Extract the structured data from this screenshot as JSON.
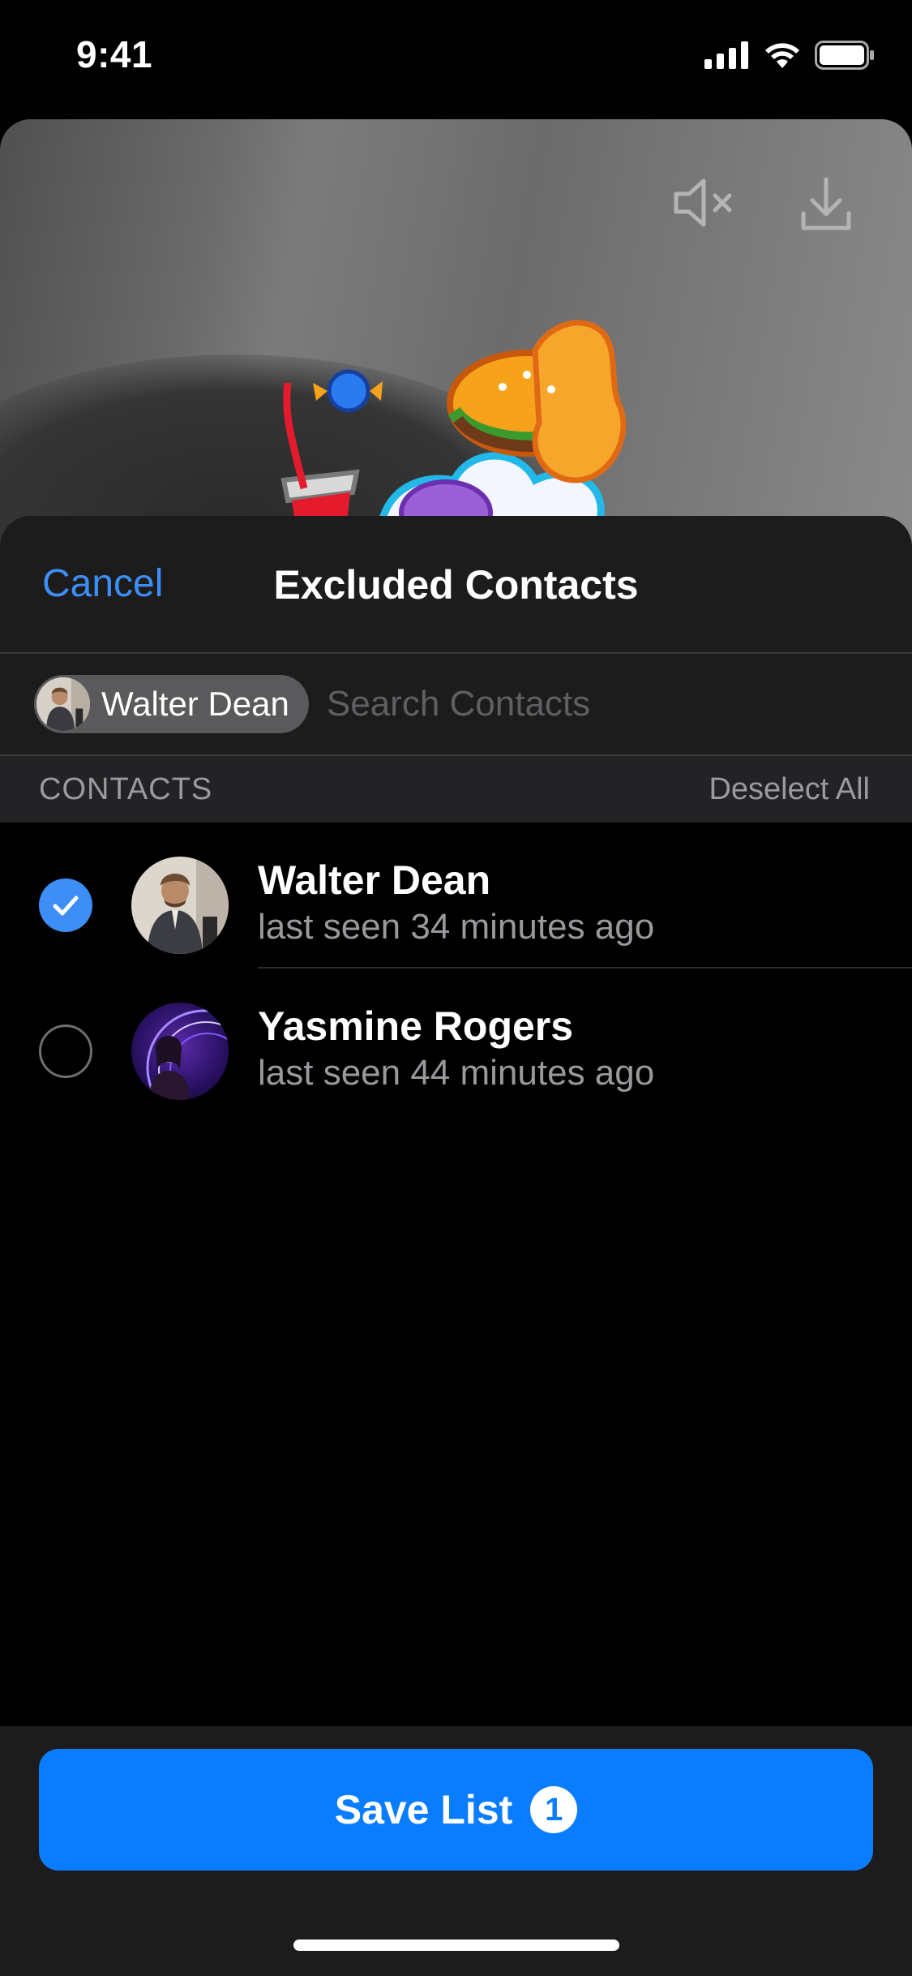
{
  "status_bar": {
    "time": "9:41",
    "icons": [
      "cellular-signal-icon",
      "wifi-icon",
      "battery-icon"
    ]
  },
  "preview": {
    "controls": [
      "mute-icon",
      "download-icon"
    ],
    "sticker": "food-sticker"
  },
  "sheet": {
    "cancel_label": "Cancel",
    "title": "Excluded Contacts",
    "selected_chips": [
      {
        "label": "Walter Dean"
      }
    ],
    "search": {
      "placeholder": "Search Contacts",
      "value": ""
    },
    "section": {
      "label": "CONTACTS",
      "action_label": "Deselect All"
    },
    "contacts": [
      {
        "name": "Walter Dean",
        "status": "last seen 34 minutes ago",
        "selected": true
      },
      {
        "name": "Yasmine Rogers",
        "status": "last seen 44 minutes ago",
        "selected": false
      }
    ]
  },
  "footer": {
    "save_label": "Save List",
    "save_count": "1"
  },
  "colors": {
    "accent": "#0a7cff",
    "link": "#3e8ef7",
    "sheet_background": "#1c1c1d"
  }
}
